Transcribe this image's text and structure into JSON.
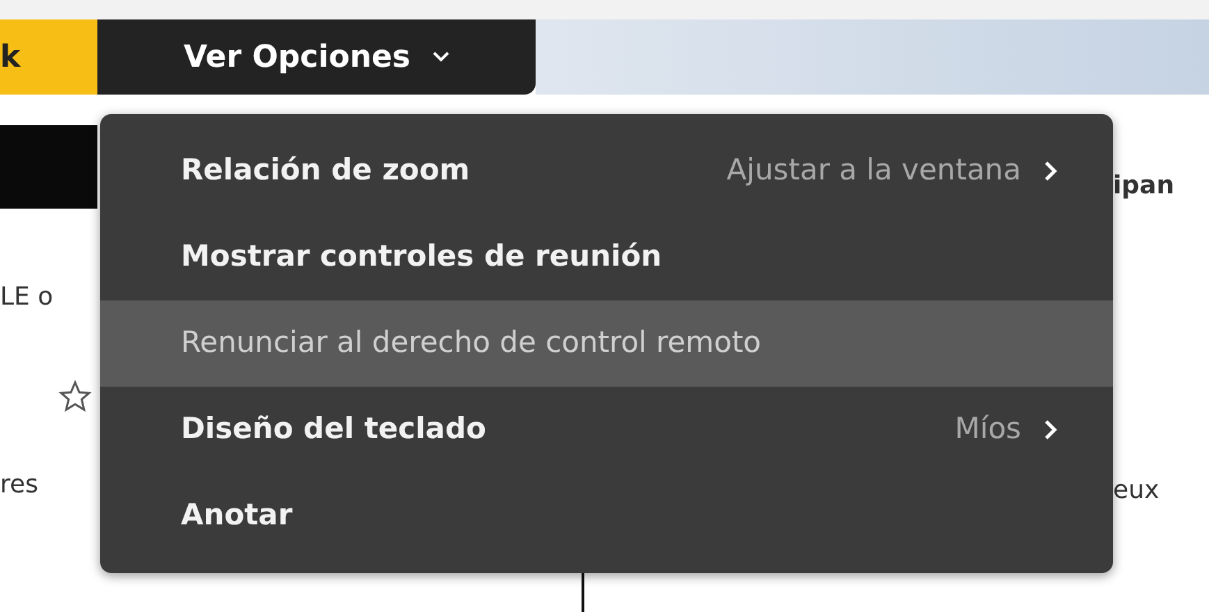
{
  "toolbar": {
    "left_tab": "k",
    "view_options": {
      "label": "Ver Opciones",
      "expanded": true
    }
  },
  "background": {
    "left_texts": [
      "LE o",
      "res"
    ],
    "right_texts": [
      "ipan",
      "eux"
    ]
  },
  "menu": {
    "items": [
      {
        "kind": "submenu",
        "label": "Relación de zoom",
        "value": "Ajustar a la ventana",
        "selected": false
      },
      {
        "kind": "action",
        "label": "Mostrar controles de reunión",
        "selected": false
      },
      {
        "kind": "action",
        "label": "Renunciar al derecho de control remoto",
        "selected": true
      },
      {
        "kind": "submenu",
        "label": "Diseño del teclado",
        "value": "Míos",
        "selected": false
      },
      {
        "kind": "action",
        "label": "Anotar",
        "selected": false
      }
    ]
  }
}
